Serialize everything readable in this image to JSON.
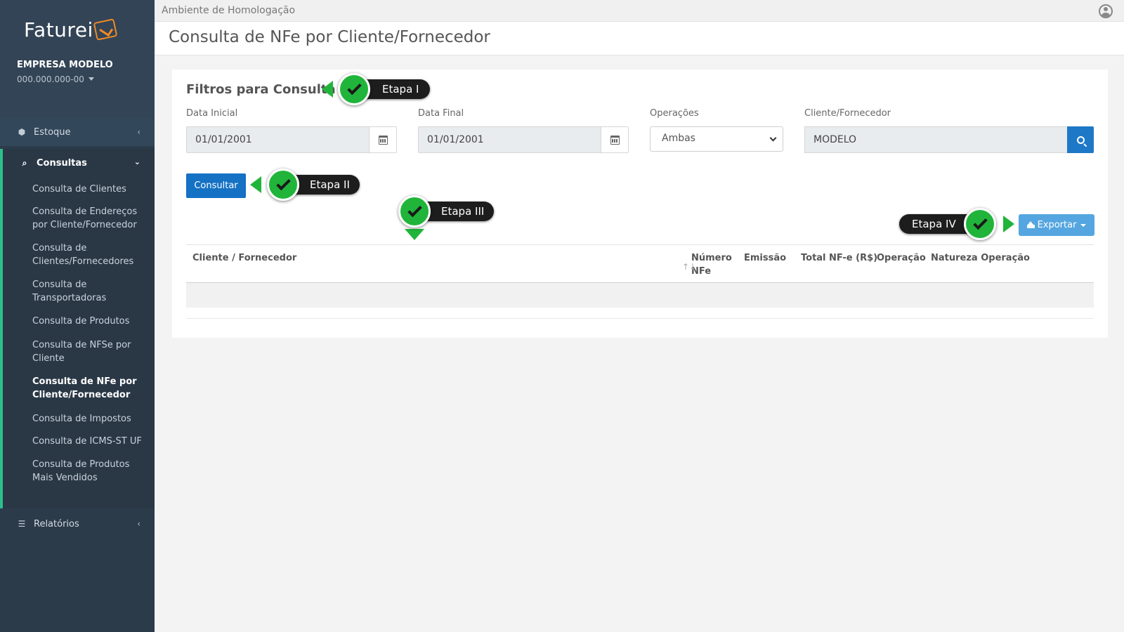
{
  "brand": {
    "name": "Faturei"
  },
  "company": {
    "name": "EMPRESA MODELO",
    "doc": "000.000.000-00"
  },
  "sidebar": {
    "estoque": "Estoque",
    "consultas": "Consultas",
    "relatorios": "Relatórios",
    "items": [
      "Consulta de Clientes",
      "Consulta de Endereços por Cliente/Fornecedor",
      "Consulta de Clientes/Fornecedores",
      "Consulta de Transportadoras",
      "Consulta de Produtos",
      "Consulta de NFSe por Cliente",
      "Consulta de NFe por Cliente/Fornecedor",
      "Consulta de Impostos",
      "Consulta de ICMS-ST UF",
      "Consulta de Produtos Mais Vendidos"
    ],
    "active_item": "Consulta de NFe por Cliente/Fornecedor"
  },
  "header": {
    "environment": "Ambiente de Homologação",
    "page_title": "Consulta de NFe por Cliente/Fornecedor"
  },
  "filters": {
    "title": "Filtros para Consulta",
    "data_inicial_label": "Data Inicial",
    "data_inicial_value": "01/01/2001",
    "data_final_label": "Data Final",
    "data_final_value": "01/01/2001",
    "operacoes_label": "Operações",
    "operacoes_value": "Ambas",
    "cliente_label": "Cliente/Fornecedor",
    "cliente_value": "MODELO"
  },
  "actions": {
    "consultar": "Consultar",
    "exportar": "Exportar"
  },
  "table": {
    "columns": [
      "Cliente / Fornecedor",
      "Número NFe",
      "Emissão",
      "Total NF-e (R$)",
      "Operação",
      "Natureza Operação"
    ],
    "col_numero_line1": "Número",
    "col_numero_line2": "NFe",
    "sort_glyph": "↑↓"
  },
  "steps": {
    "s1": "Etapa I",
    "s2": "Etapa II",
    "s3": "Etapa III",
    "s4": "Etapa IV"
  },
  "colors": {
    "sidebar": "#2c3b4a",
    "accent": "#2bbf8d",
    "primary": "#1471c4",
    "step_green": "#20b53a"
  }
}
